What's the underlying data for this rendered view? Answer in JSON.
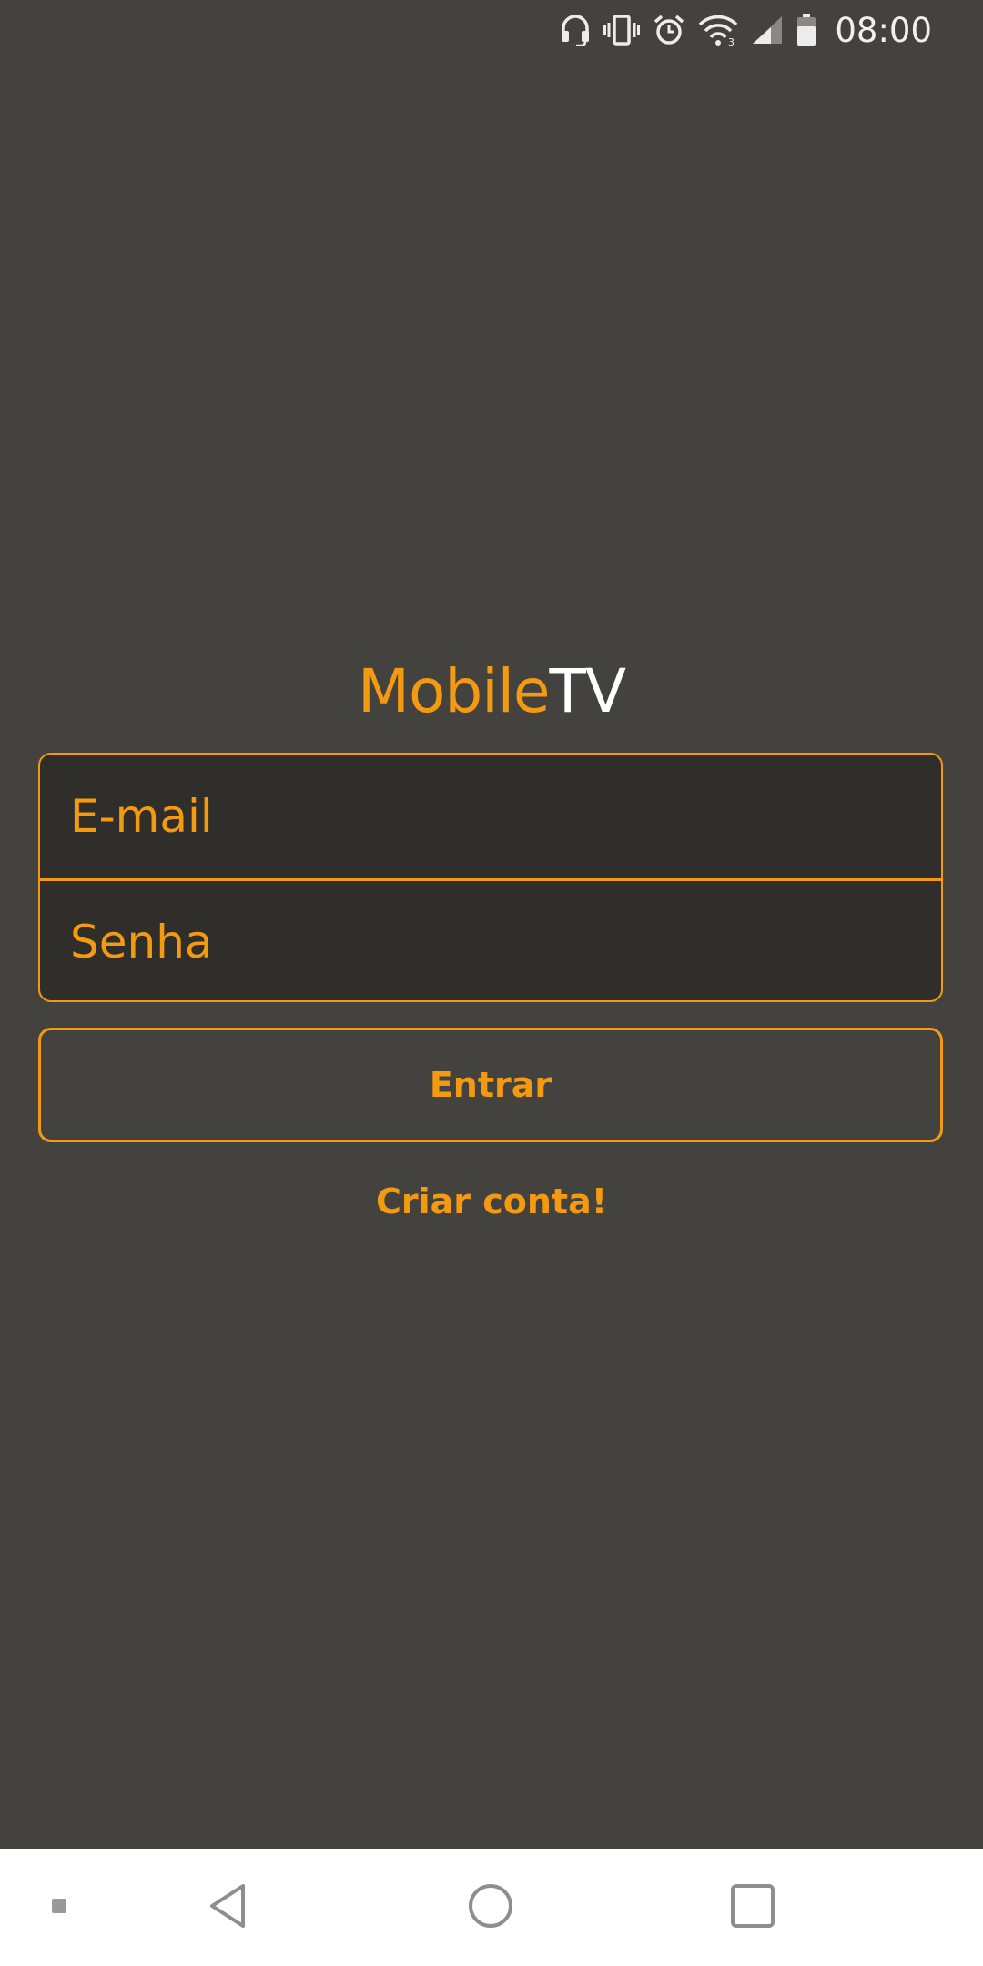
{
  "status_bar": {
    "time": "08:00",
    "icons": [
      "headset-icon",
      "vibrate-icon",
      "alarm-icon",
      "wifi-icon",
      "signal-icon",
      "battery-icon"
    ]
  },
  "logo": {
    "part1": "Mobile",
    "part2": "TV"
  },
  "form": {
    "email_placeholder": "E-mail",
    "password_placeholder": "Senha",
    "email_value": "",
    "password_value": ""
  },
  "actions": {
    "login_label": "Entrar",
    "create_account_label": "Criar conta!"
  },
  "nav_bar": {
    "icons": [
      "menu-dot-icon",
      "back-icon",
      "home-icon",
      "recents-icon"
    ]
  },
  "colors": {
    "accent": "#f49a11",
    "background": "#44423e",
    "field_background": "#302e2b",
    "nav_background": "#ffffff"
  }
}
